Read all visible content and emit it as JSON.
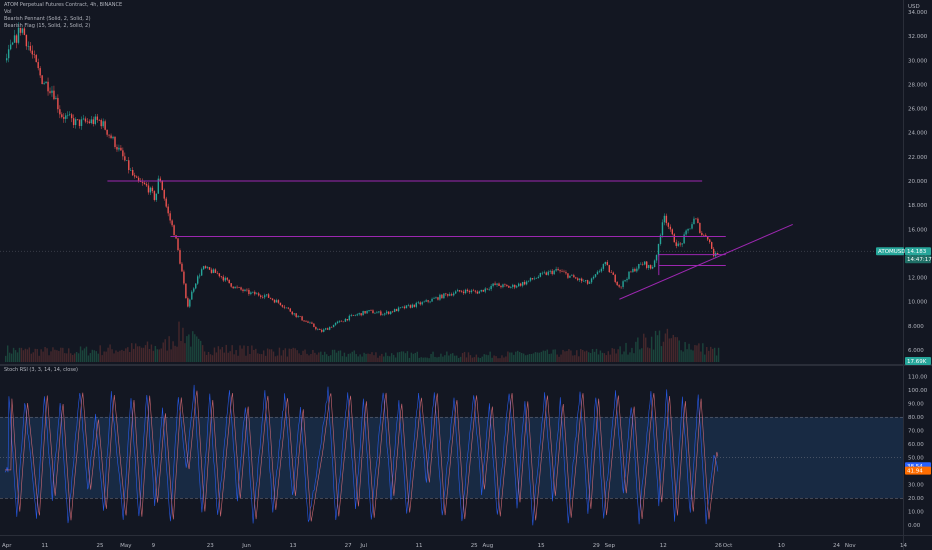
{
  "header": {
    "title": "ATOM Perpetual Futures Contract, 4h, BINANCE",
    "indicators": [
      "Vol",
      "Bearish Pennant (Solid, 2, Solid, 2)",
      "Bearish Flag (15, Solid, 2, Solid, 2)"
    ]
  },
  "stoch_label": "Stoch RSI (3, 3, 14, 14, close)",
  "currency": "USD",
  "colors": {
    "background": "#131722",
    "price_tag": "#26a69a",
    "pattern_lines": "#9c27b0",
    "up": "#26a69a",
    "down": "#ef5350",
    "k_line": "#2962ff",
    "d_line": "#ff6d00",
    "stoch_band": "#1e3a5f"
  },
  "tags": {
    "symbol": "ATOMUSDT.P",
    "last_price": "14.183",
    "countdown": "14:47:17",
    "volume": "17.69K",
    "stoch_k": "38.54",
    "stoch_d": "41.94"
  },
  "chart_data": [
    {
      "type": "candlestick",
      "name": "ATOMUSDT.P 4h",
      "ylim": [
        5,
        35
      ],
      "price_axis_ticks": [
        "34.000",
        "32.000",
        "30.000",
        "28.000",
        "26.000",
        "24.000",
        "22.000",
        "20.000",
        "18.000",
        "16.000",
        "14.000",
        "12.000",
        "10.000",
        "8.000",
        "6.000"
      ],
      "x_axis_ticks": [
        "Apr",
        "11",
        "25",
        "May",
        "9",
        "23",
        "Jun",
        "13",
        "27",
        "Jul",
        "11",
        "25",
        "Aug",
        "15",
        "29",
        "Sep",
        "12",
        "26",
        "Oct",
        "10",
        "24",
        "Nov",
        "14"
      ],
      "price_path": [
        {
          "d": 0,
          "p": 30.0
        },
        {
          "d": 4,
          "p": 32.8
        },
        {
          "d": 6,
          "p": 31.0
        },
        {
          "d": 9,
          "p": 28.5
        },
        {
          "d": 12,
          "p": 27.5
        },
        {
          "d": 14,
          "p": 25.5
        },
        {
          "d": 18,
          "p": 24.8
        },
        {
          "d": 24,
          "p": 25.0
        },
        {
          "d": 28,
          "p": 23.0
        },
        {
          "d": 33,
          "p": 20.0
        },
        {
          "d": 36,
          "p": 19.5
        },
        {
          "d": 38,
          "p": 18.5
        },
        {
          "d": 39,
          "p": 20.5
        },
        {
          "d": 41,
          "p": 17.5
        },
        {
          "d": 43,
          "p": 15.5
        },
        {
          "d": 45,
          "p": 12.0
        },
        {
          "d": 46,
          "p": 9.5
        },
        {
          "d": 48,
          "p": 11.5
        },
        {
          "d": 50,
          "p": 12.8
        },
        {
          "d": 54,
          "p": 12.3
        },
        {
          "d": 58,
          "p": 11.2
        },
        {
          "d": 62,
          "p": 10.7
        },
        {
          "d": 66,
          "p": 10.5
        },
        {
          "d": 70,
          "p": 9.8
        },
        {
          "d": 74,
          "p": 8.8
        },
        {
          "d": 78,
          "p": 8.0
        },
        {
          "d": 80,
          "p": 7.5
        },
        {
          "d": 84,
          "p": 8.2
        },
        {
          "d": 88,
          "p": 8.8
        },
        {
          "d": 92,
          "p": 9.2
        },
        {
          "d": 96,
          "p": 9.0
        },
        {
          "d": 100,
          "p": 9.4
        },
        {
          "d": 106,
          "p": 9.9
        },
        {
          "d": 112,
          "p": 10.6
        },
        {
          "d": 116,
          "p": 10.9
        },
        {
          "d": 120,
          "p": 10.8
        },
        {
          "d": 124,
          "p": 11.4
        },
        {
          "d": 128,
          "p": 11.2
        },
        {
          "d": 132,
          "p": 11.6
        },
        {
          "d": 136,
          "p": 12.2
        },
        {
          "d": 140,
          "p": 12.6
        },
        {
          "d": 144,
          "p": 12.0
        },
        {
          "d": 148,
          "p": 11.5
        },
        {
          "d": 150,
          "p": 12.2
        },
        {
          "d": 152,
          "p": 13.2
        },
        {
          "d": 154,
          "p": 12.2
        },
        {
          "d": 156,
          "p": 11.2
        },
        {
          "d": 158,
          "p": 12.2
        },
        {
          "d": 160,
          "p": 12.8
        },
        {
          "d": 162,
          "p": 13.2
        },
        {
          "d": 164,
          "p": 12.7
        },
        {
          "d": 166,
          "p": 14.8
        },
        {
          "d": 167,
          "p": 17.5
        },
        {
          "d": 169,
          "p": 15.5
        },
        {
          "d": 171,
          "p": 14.5
        },
        {
          "d": 173,
          "p": 15.8
        },
        {
          "d": 175,
          "p": 16.9
        },
        {
          "d": 177,
          "p": 15.4
        },
        {
          "d": 178,
          "p": 15.6
        },
        {
          "d": 180,
          "p": 13.7
        },
        {
          "d": 181,
          "p": 14.18
        }
      ],
      "volume_profile": [
        {
          "d": 0,
          "v": 0.35
        },
        {
          "d": 15,
          "v": 0.3
        },
        {
          "d": 40,
          "v": 0.45
        },
        {
          "d": 45,
          "v": 0.9
        },
        {
          "d": 50,
          "v": 0.4
        },
        {
          "d": 80,
          "v": 0.25
        },
        {
          "d": 120,
          "v": 0.2
        },
        {
          "d": 155,
          "v": 0.3
        },
        {
          "d": 166,
          "v": 0.75
        },
        {
          "d": 175,
          "v": 0.45
        },
        {
          "d": 181,
          "v": 0.3
        }
      ],
      "pattern_lines": [
        {
          "from": {
            "d": 26,
            "p": 20.0
          },
          "to": {
            "d": 177,
            "p": 20.0
          }
        },
        {
          "from": {
            "d": 42,
            "p": 15.4
          },
          "to": {
            "d": 183,
            "p": 15.4
          }
        },
        {
          "from": {
            "d": 166,
            "p": 13.9
          },
          "to": {
            "d": 183,
            "p": 13.9
          }
        },
        {
          "from": {
            "d": 166,
            "p": 13.0
          },
          "to": {
            "d": 183,
            "p": 13.0
          }
        },
        {
          "from": {
            "d": 156,
            "p": 10.2
          },
          "to": {
            "d": 200,
            "p": 16.4
          }
        },
        {
          "from": {
            "d": 166,
            "p": 13.9
          },
          "to": {
            "d": 166,
            "p": 12.2
          }
        }
      ]
    },
    {
      "type": "line",
      "name": "Stoch RSI",
      "ylim": [
        -5,
        112
      ],
      "axis_ticks": [
        "110.00",
        "100.00",
        "90.00",
        "80.00",
        "70.00",
        "60.00",
        "50.00",
        "40.00",
        "30.00",
        "20.00",
        "10.00",
        "0.00"
      ],
      "bands": {
        "upper": 80,
        "middle": 50,
        "lower": 20
      },
      "series": [
        {
          "label": "K",
          "color": "#2962ff"
        },
        {
          "label": "D",
          "color": "#ff6d00"
        }
      ],
      "peaks": [
        {
          "d": 1,
          "v": 96
        },
        {
          "d": 3,
          "v": 8
        },
        {
          "d": 5,
          "v": 92
        },
        {
          "d": 8,
          "v": 5
        },
        {
          "d": 10,
          "v": 98
        },
        {
          "d": 12,
          "v": 20
        },
        {
          "d": 14,
          "v": 92
        },
        {
          "d": 16,
          "v": 2
        },
        {
          "d": 19,
          "v": 100
        },
        {
          "d": 21,
          "v": 25
        },
        {
          "d": 23,
          "v": 80
        },
        {
          "d": 25,
          "v": 10
        },
        {
          "d": 27,
          "v": 98
        },
        {
          "d": 30,
          "v": 5
        },
        {
          "d": 32,
          "v": 95
        },
        {
          "d": 34,
          "v": 4
        },
        {
          "d": 36,
          "v": 98
        },
        {
          "d": 38,
          "v": 15
        },
        {
          "d": 40,
          "v": 85
        },
        {
          "d": 42,
          "v": 2
        },
        {
          "d": 44,
          "v": 96
        },
        {
          "d": 46,
          "v": 40
        },
        {
          "d": 48,
          "v": 102
        },
        {
          "d": 50,
          "v": 8
        },
        {
          "d": 52,
          "v": 95
        },
        {
          "d": 54,
          "v": 5
        },
        {
          "d": 57,
          "v": 100
        },
        {
          "d": 59,
          "v": 18
        },
        {
          "d": 61,
          "v": 90
        },
        {
          "d": 63,
          "v": 3
        },
        {
          "d": 66,
          "v": 98
        },
        {
          "d": 68,
          "v": 10
        },
        {
          "d": 71,
          "v": 96
        },
        {
          "d": 73,
          "v": 20
        },
        {
          "d": 75,
          "v": 88
        },
        {
          "d": 77,
          "v": 2
        },
        {
          "d": 80,
          "v": 55
        },
        {
          "d": 82,
          "v": 100
        },
        {
          "d": 84,
          "v": 5
        },
        {
          "d": 87,
          "v": 98
        },
        {
          "d": 89,
          "v": 12
        },
        {
          "d": 91,
          "v": 94
        },
        {
          "d": 93,
          "v": 4
        },
        {
          "d": 96,
          "v": 100
        },
        {
          "d": 98,
          "v": 20
        },
        {
          "d": 100,
          "v": 92
        },
        {
          "d": 102,
          "v": 8
        },
        {
          "d": 105,
          "v": 96
        },
        {
          "d": 107,
          "v": 30
        },
        {
          "d": 109,
          "v": 100
        },
        {
          "d": 111,
          "v": 6
        },
        {
          "d": 114,
          "v": 95
        },
        {
          "d": 116,
          "v": 3
        },
        {
          "d": 119,
          "v": 98
        },
        {
          "d": 121,
          "v": 25
        },
        {
          "d": 123,
          "v": 90
        },
        {
          "d": 125,
          "v": 5
        },
        {
          "d": 128,
          "v": 100
        },
        {
          "d": 130,
          "v": 15
        },
        {
          "d": 132,
          "v": 94
        },
        {
          "d": 134,
          "v": 2
        },
        {
          "d": 137,
          "v": 98
        },
        {
          "d": 139,
          "v": 20
        },
        {
          "d": 141,
          "v": 92
        },
        {
          "d": 143,
          "v": 4
        },
        {
          "d": 146,
          "v": 100
        },
        {
          "d": 148,
          "v": 10
        },
        {
          "d": 150,
          "v": 96
        },
        {
          "d": 152,
          "v": 6
        },
        {
          "d": 155,
          "v": 98
        },
        {
          "d": 157,
          "v": 22
        },
        {
          "d": 159,
          "v": 90
        },
        {
          "d": 161,
          "v": 3
        },
        {
          "d": 164,
          "v": 100
        },
        {
          "d": 166,
          "v": 15
        },
        {
          "d": 168,
          "v": 98
        },
        {
          "d": 170,
          "v": 5
        },
        {
          "d": 172,
          "v": 94
        },
        {
          "d": 174,
          "v": 8
        },
        {
          "d": 176,
          "v": 96
        },
        {
          "d": 178,
          "v": 3
        },
        {
          "d": 180,
          "v": 55
        },
        {
          "d": 181,
          "v": 41
        }
      ]
    }
  ]
}
